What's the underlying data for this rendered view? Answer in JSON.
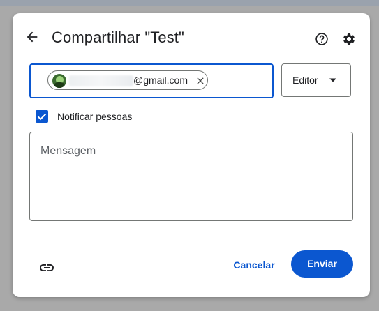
{
  "dialog": {
    "title": "Compartilhar \"Test\"",
    "icons": {
      "back": "arrow-back-icon",
      "help": "help-circle-icon",
      "settings": "gear-icon",
      "copy_link": "link-icon"
    }
  },
  "recipients": {
    "chip_email": "@gmail.com",
    "chip_remove_icon": "close-icon"
  },
  "role": {
    "selected": "Editor",
    "caret_icon": "caret-down-icon"
  },
  "notify": {
    "label": "Notificar pessoas",
    "checked": true
  },
  "message": {
    "placeholder": "Mensagem"
  },
  "actions": {
    "cancel_label": "Cancelar",
    "send_label": "Enviar"
  },
  "colors": {
    "accent": "#0b57d0",
    "text": "#202124",
    "border": "#747775"
  }
}
